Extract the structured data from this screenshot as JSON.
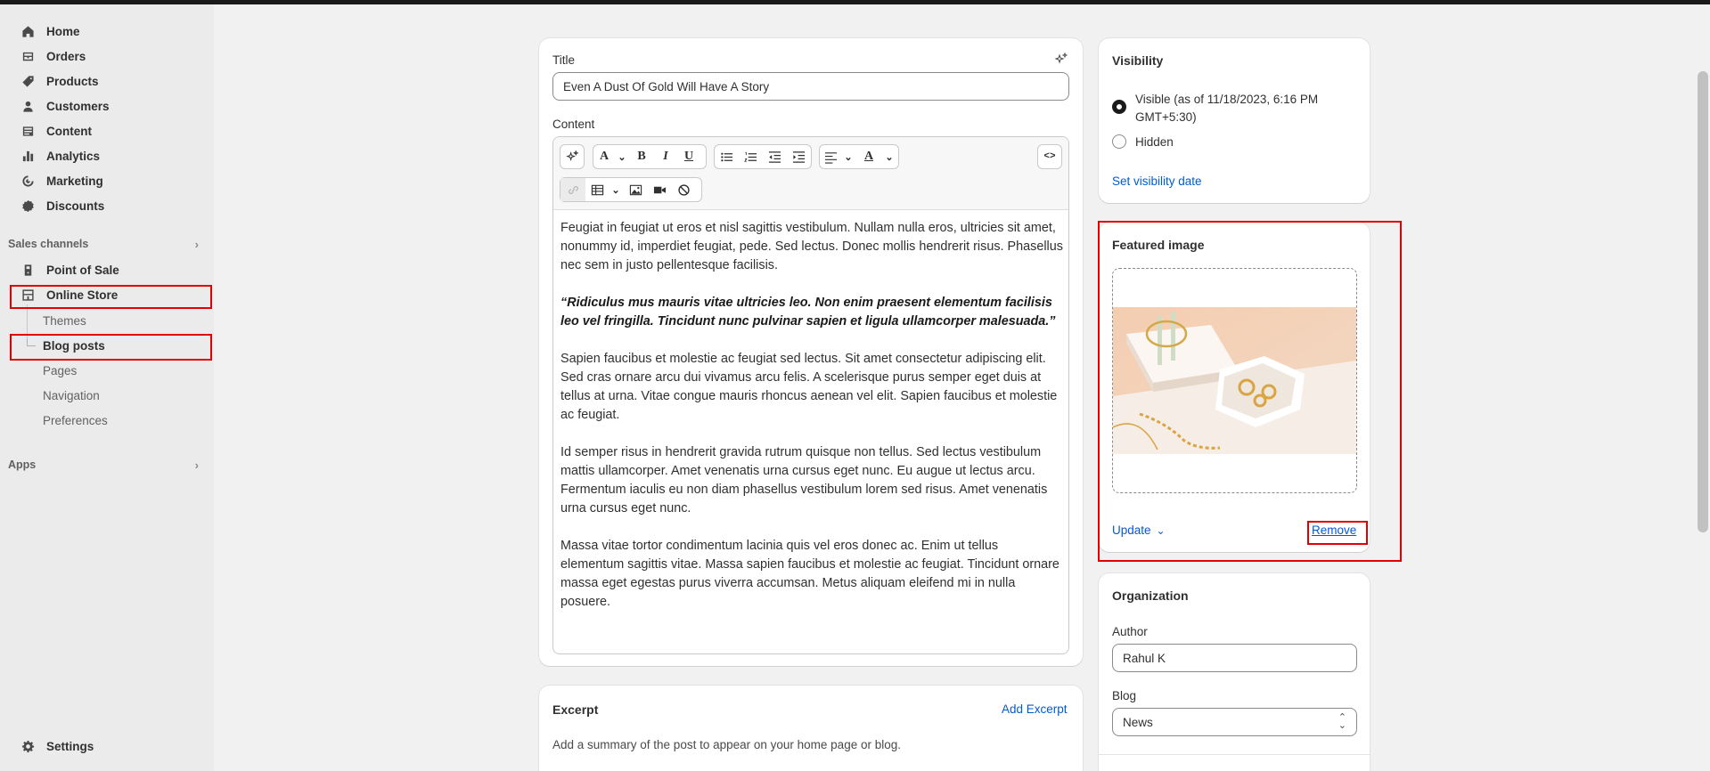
{
  "sidebar": {
    "items": [
      {
        "label": "Home",
        "icon": "home-icon"
      },
      {
        "label": "Orders",
        "icon": "orders-icon"
      },
      {
        "label": "Products",
        "icon": "tag-icon"
      },
      {
        "label": "Customers",
        "icon": "person-icon"
      },
      {
        "label": "Content",
        "icon": "content-icon"
      },
      {
        "label": "Analytics",
        "icon": "bar-chart-icon"
      },
      {
        "label": "Marketing",
        "icon": "target-icon"
      },
      {
        "label": "Discounts",
        "icon": "discount-icon"
      }
    ],
    "sales_channels_label": "Sales channels",
    "point_of_sale": "Point of Sale",
    "online_store": "Online Store",
    "online_store_sub": [
      "Themes",
      "Blog posts",
      "Pages",
      "Navigation",
      "Preferences"
    ],
    "apps_label": "Apps",
    "settings_label": "Settings"
  },
  "editor": {
    "title_label": "Title",
    "title_value": "Even A Dust Of Gold Will Have A Story",
    "content_label": "Content",
    "paragraphs": [
      "Feugiat in feugiat ut eros et nisl sagittis vestibulum. Nullam nulla eros, ultricies sit amet, nonummy id, imperdiet feugiat, pede. Sed lectus. Donec mollis hendrerit risus. Phasellus nec sem in justo pellentesque facilisis.",
      "“Ridiculus mus mauris vitae ultricies leo. Non enim praesent elementum facilisis leo vel fringilla. Tincidunt nunc pulvinar sapien et ligula ullamcorper malesuada.”",
      "Sapien faucibus et molestie ac feugiat sed lectus. Sit amet consectetur adipiscing elit. Sed cras ornare arcu dui vivamus arcu felis. A scelerisque purus semper eget duis at tellus at urna. Vitae congue mauris rhoncus aenean vel elit. Sapien faucibus et molestie ac feugiat.",
      "Id semper risus in hendrerit gravida rutrum quisque non tellus. Sed lectus vestibulum mattis ullamcorper. Amet venenatis urna cursus eget nunc. Eu augue ut lectus arcu. Fermentum iaculis eu non diam phasellus vestibulum lorem sed risus. Amet venenatis urna cursus eget nunc.",
      "Massa vitae tortor condimentum lacinia quis vel eros donec ac. Enim ut tellus elementum sagittis vitae. Massa sapien faucibus et molestie ac feugiat. Tincidunt ornare massa eget egestas purus viverra accumsan. Metus aliquam eleifend mi in nulla posuere."
    ],
    "toolbar": {
      "font_letter": "A",
      "bold": "B",
      "italic": "I",
      "underline": "U",
      "text_color_letter": "A",
      "code_label": "<>"
    }
  },
  "excerpt": {
    "title": "Excerpt",
    "add_link": "Add Excerpt",
    "description": "Add a summary of the post to appear on your home page or blog."
  },
  "visibility": {
    "title": "Visibility",
    "visible_label": "Visible (as of 11/18/2023, 6:16 PM GMT+5:30)",
    "hidden_label": "Hidden",
    "selected": "visible",
    "set_date_link": "Set visibility date"
  },
  "featured": {
    "title": "Featured image",
    "update_label": "Update",
    "remove_label": "Remove"
  },
  "organization": {
    "title": "Organization",
    "author_label": "Author",
    "author_value": "Rahul K",
    "blog_label": "Blog",
    "blog_value": "News"
  },
  "colors": {
    "highlight": "#e00000",
    "link": "#005bd3",
    "sidebar_bg": "#ebebeb",
    "page_bg": "#f1f1f1"
  }
}
